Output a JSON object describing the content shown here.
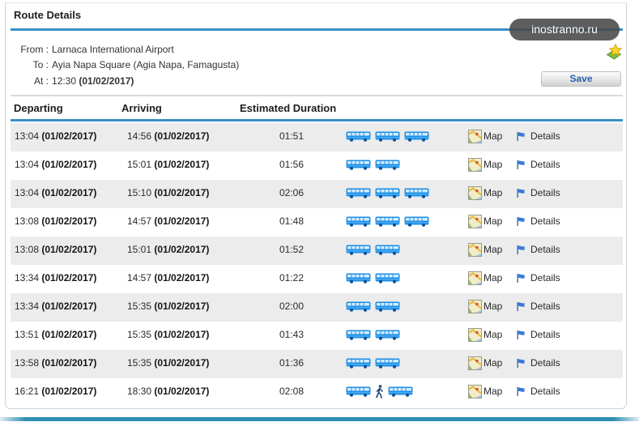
{
  "panel": {
    "title": "Route Details"
  },
  "watermark": {
    "text": "inostranno.ru"
  },
  "route": {
    "from_label": "From :",
    "from_value": "Larnaca International Airport",
    "to_label": "To :",
    "to_value": "Ayia Napa Square (Agia Napa, Famagusta)",
    "at_label": "At :",
    "at_time": "12:30",
    "at_date": "(01/02/2017)"
  },
  "toolbar": {
    "save_label": "Save",
    "favorite_icon": "star-icon"
  },
  "table": {
    "columns": {
      "departing": "Departing",
      "arriving": "Arriving",
      "duration": "Estimated Duration"
    },
    "map_label": "Map",
    "details_label": "Details",
    "rows": [
      {
        "dep_time": "13:04",
        "dep_date": "(01/02/2017)",
        "arr_time": "14:56",
        "arr_date": "(01/02/2017)",
        "duration": "01:51",
        "legs": [
          "bus-icon",
          "bus-icon",
          "bus-icon"
        ]
      },
      {
        "dep_time": "13:04",
        "dep_date": "(01/02/2017)",
        "arr_time": "15:01",
        "arr_date": "(01/02/2017)",
        "duration": "01:56",
        "legs": [
          "bus-icon",
          "bus-icon"
        ]
      },
      {
        "dep_time": "13:04",
        "dep_date": "(01/02/2017)",
        "arr_time": "15:10",
        "arr_date": "(01/02/2017)",
        "duration": "02:06",
        "legs": [
          "bus-icon",
          "bus-icon",
          "bus-icon"
        ]
      },
      {
        "dep_time": "13:08",
        "dep_date": "(01/02/2017)",
        "arr_time": "14:57",
        "arr_date": "(01/02/2017)",
        "duration": "01:48",
        "legs": [
          "bus-icon",
          "bus-icon",
          "bus-icon"
        ]
      },
      {
        "dep_time": "13:08",
        "dep_date": "(01/02/2017)",
        "arr_time": "15:01",
        "arr_date": "(01/02/2017)",
        "duration": "01:52",
        "legs": [
          "bus-icon",
          "bus-icon"
        ]
      },
      {
        "dep_time": "13:34",
        "dep_date": "(01/02/2017)",
        "arr_time": "14:57",
        "arr_date": "(01/02/2017)",
        "duration": "01:22",
        "legs": [
          "bus-icon",
          "bus-icon"
        ]
      },
      {
        "dep_time": "13:34",
        "dep_date": "(01/02/2017)",
        "arr_time": "15:35",
        "arr_date": "(01/02/2017)",
        "duration": "02:00",
        "legs": [
          "bus-icon",
          "bus-icon"
        ]
      },
      {
        "dep_time": "13:51",
        "dep_date": "(01/02/2017)",
        "arr_time": "15:35",
        "arr_date": "(01/02/2017)",
        "duration": "01:43",
        "legs": [
          "bus-icon",
          "bus-icon"
        ]
      },
      {
        "dep_time": "13:58",
        "dep_date": "(01/02/2017)",
        "arr_time": "15:35",
        "arr_date": "(01/02/2017)",
        "duration": "01:36",
        "legs": [
          "bus-icon",
          "bus-icon"
        ]
      },
      {
        "dep_time": "16:21",
        "dep_date": "(01/02/2017)",
        "arr_time": "18:30",
        "arr_date": "(01/02/2017)",
        "duration": "02:08",
        "legs": [
          "bus-icon",
          "walk-icon",
          "bus-icon"
        ]
      }
    ]
  },
  "colors": {
    "accent_line": "#3a8ec8",
    "row_stripe": "#ececec",
    "save_text": "#2a62ad",
    "bus": "#1b8fe6",
    "walk": "#24477a"
  }
}
